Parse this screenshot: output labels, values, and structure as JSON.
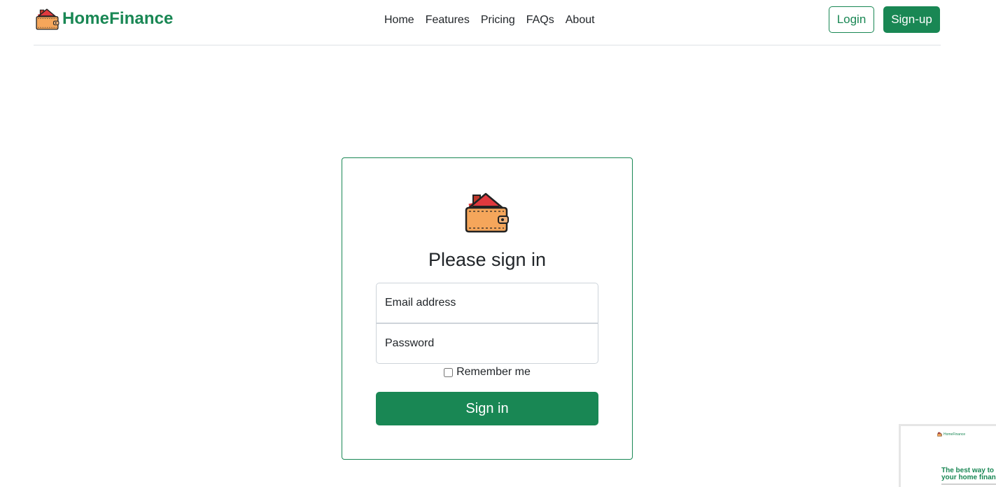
{
  "navbar": {
    "brand": "HomeFinance",
    "logo_icon": "house-wallet-icon",
    "links": [
      "Home",
      "Features",
      "Pricing",
      "FAQs",
      "About"
    ],
    "login_label": "Login",
    "signup_label": "Sign-up"
  },
  "signin": {
    "logo_icon": "house-wallet-icon",
    "title": "Please sign in",
    "email_placeholder": "Email address",
    "password_placeholder": "Password",
    "remember_label": "Remember me",
    "remember_checked": false,
    "submit_label": "Sign in"
  },
  "preview_thumbnail": {
    "brand": "HomeFinance",
    "headline": "The best way to m\nyour home financ"
  },
  "colors": {
    "accent": "#198754",
    "text": "#212529",
    "border": "#ced4da",
    "divider": "#dee2e6",
    "wallet": "#f5a65b",
    "roof": "#e0393e"
  }
}
